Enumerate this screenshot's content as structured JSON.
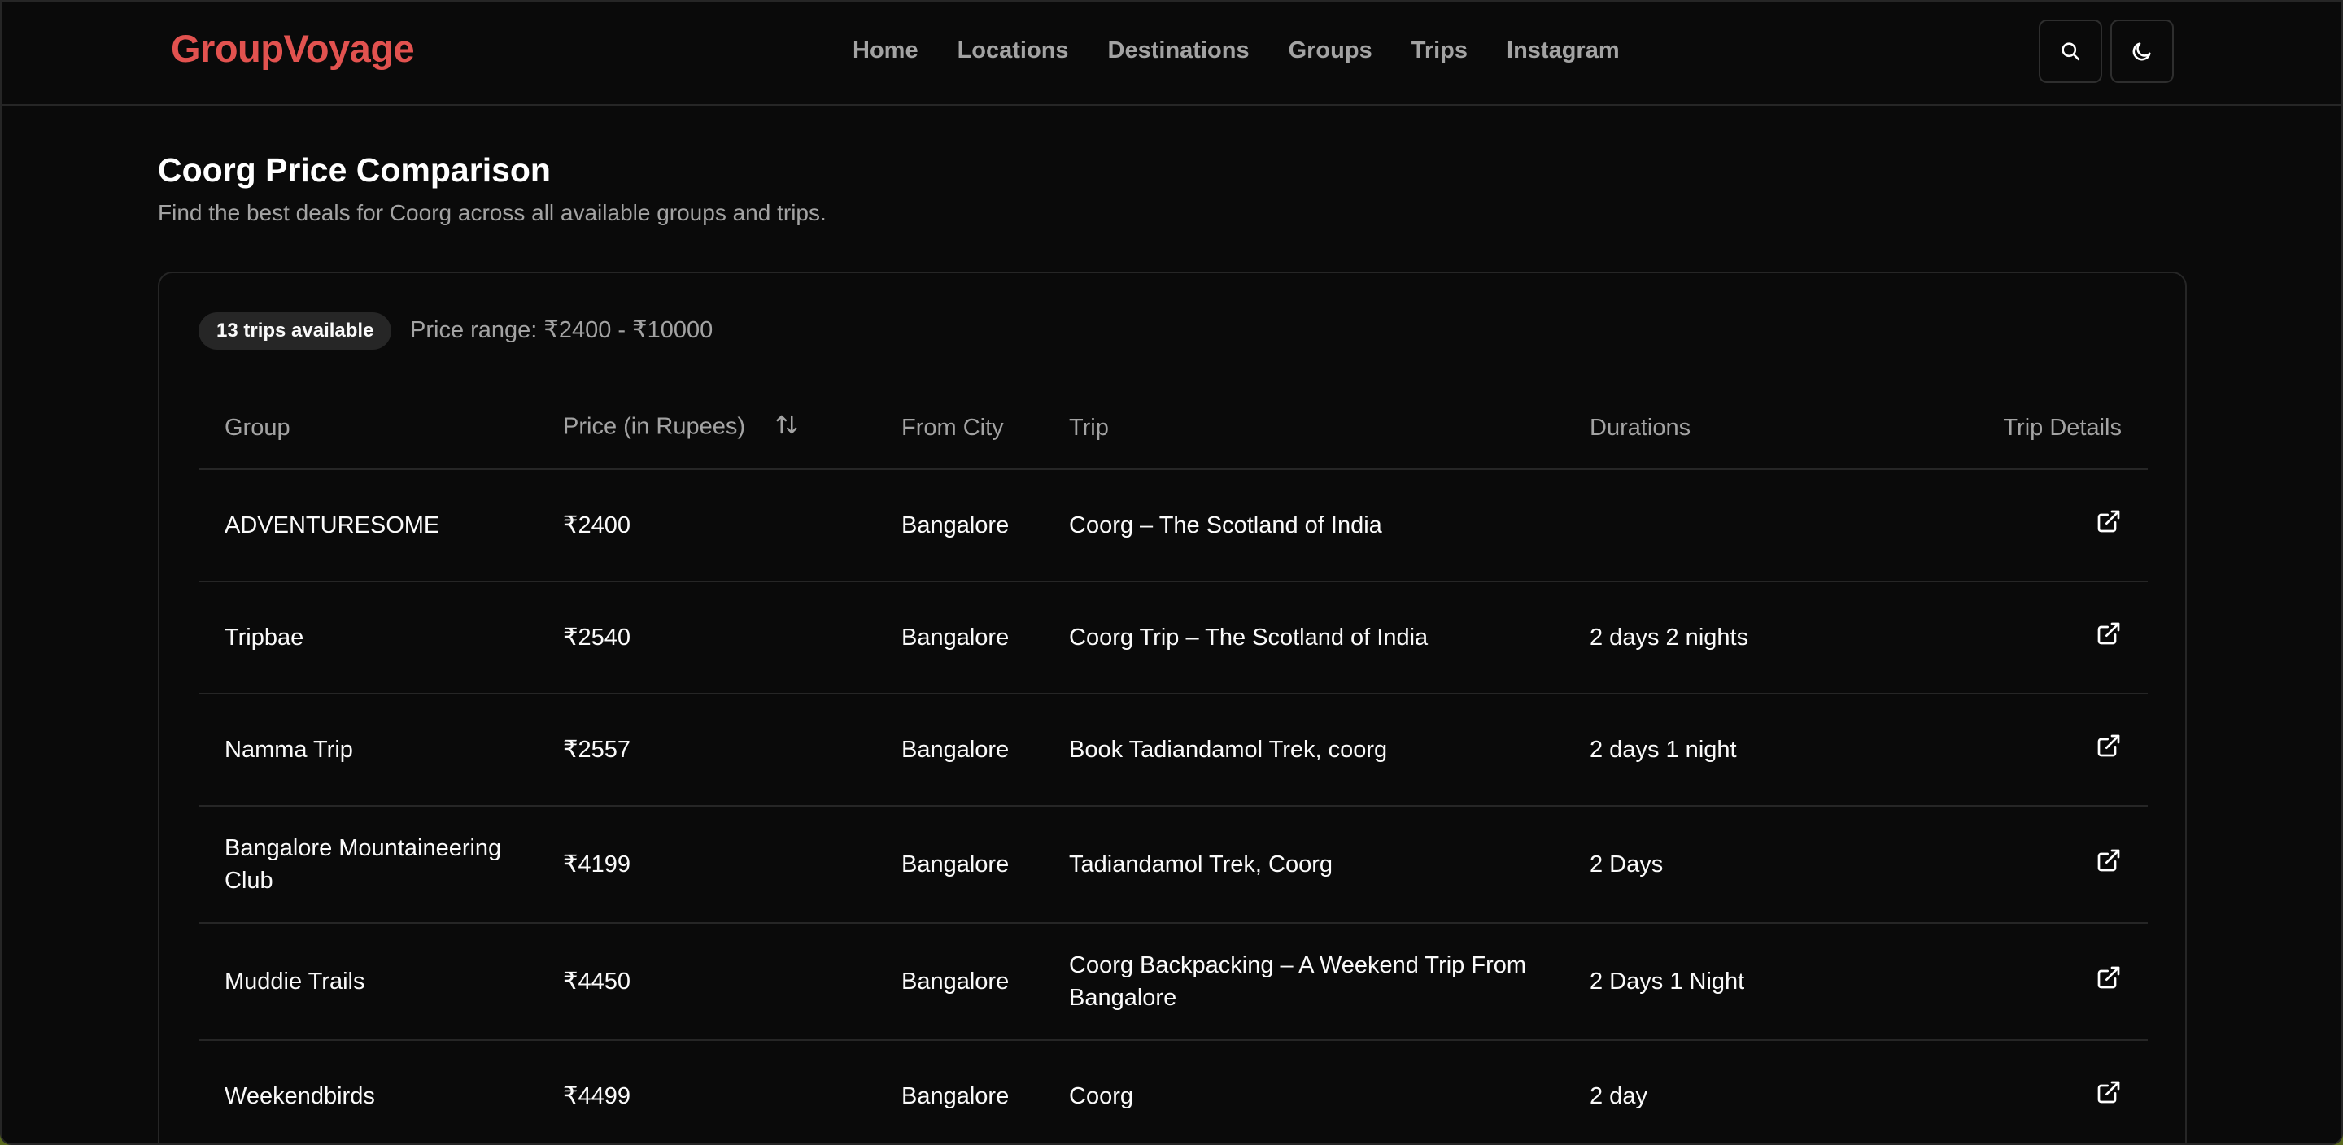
{
  "header": {
    "logo": "GroupVoyage",
    "nav": [
      "Home",
      "Locations",
      "Destinations",
      "Groups",
      "Trips",
      "Instagram"
    ]
  },
  "page": {
    "title": "Coorg Price Comparison",
    "subtitle": "Find the best deals for Coorg across all available groups and trips."
  },
  "summary": {
    "trips_badge": "13 trips available",
    "price_range": "Price range: ₹2400 - ₹10000"
  },
  "table": {
    "columns": [
      "Group",
      "Price (in Rupees)",
      "From City",
      "Trip",
      "Durations",
      "Trip Details"
    ],
    "rows": [
      {
        "group": "ADVENTURESOME",
        "price": "₹2400",
        "city": "Bangalore",
        "trip": "Coorg – The Scotland of India",
        "duration": ""
      },
      {
        "group": "Tripbae",
        "price": "₹2540",
        "city": "Bangalore",
        "trip": "Coorg Trip – The Scotland of India",
        "duration": "2 days 2 nights"
      },
      {
        "group": "Namma Trip",
        "price": "₹2557",
        "city": "Bangalore",
        "trip": "Book Tadiandamol Trek, coorg",
        "duration": "2 days 1 night"
      },
      {
        "group": "Bangalore Mountaineering Club",
        "price": "₹4199",
        "city": "Bangalore",
        "trip": "Tadiandamol Trek, Coorg",
        "duration": "2 Days"
      },
      {
        "group": "Muddie Trails",
        "price": "₹4450",
        "city": "Bangalore",
        "trip": "Coorg Backpacking – A Weekend Trip From Bangalore",
        "duration": "2 Days 1 Night"
      },
      {
        "group": "Weekendbirds",
        "price": "₹4499",
        "city": "Bangalore",
        "trip": "Coorg",
        "duration": "2 day"
      }
    ]
  }
}
